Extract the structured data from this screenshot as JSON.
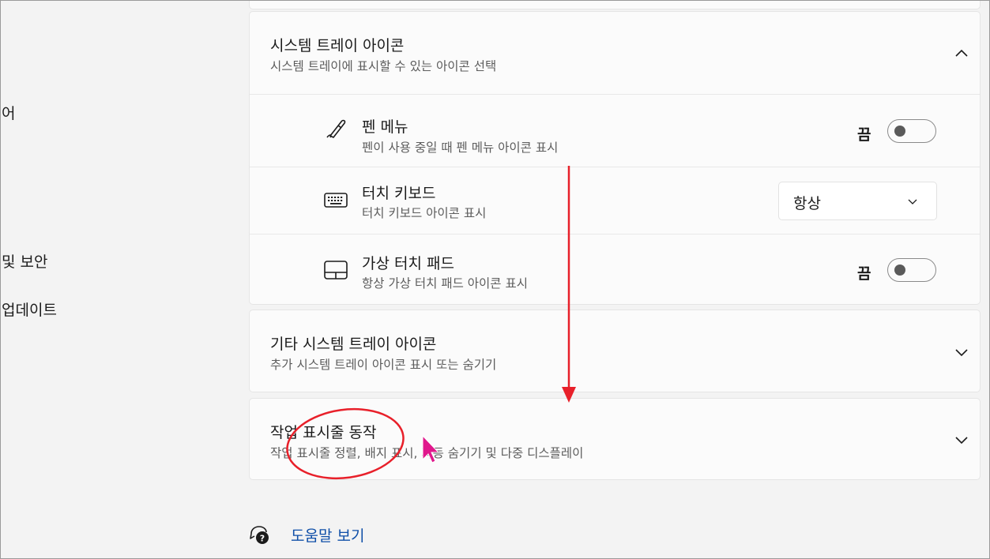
{
  "sidebar": {
    "items": [
      {
        "label": "어"
      },
      {
        "label": "및 보안"
      },
      {
        "label": "업데이트"
      }
    ]
  },
  "tray_icons_section": {
    "title": "시스템 트레이 아이콘",
    "subtitle": "시스템 트레이에 표시할 수 있는 아이콘 선택",
    "expanded": true,
    "rows": [
      {
        "icon": "pen-icon",
        "title": "펜 메뉴",
        "subtitle": "펜이 사용 중일 때 펜 메뉴 아이콘 표시",
        "control": "toggle",
        "state_label": "끔"
      },
      {
        "icon": "keyboard-icon",
        "title": "터치 키보드",
        "subtitle": "터치 키보드 아이콘 표시",
        "control": "dropdown",
        "value": "항상"
      },
      {
        "icon": "touchpad-icon",
        "title": "가상 터치 패드",
        "subtitle": "항상 가상 터치 패드 아이콘 표시",
        "control": "toggle",
        "state_label": "끔"
      }
    ]
  },
  "other_tray_section": {
    "title": "기타 시스템 트레이 아이콘",
    "subtitle": "추가 시스템 트레이 아이콘 표시 또는 숨기기"
  },
  "taskbar_behavior_section": {
    "title": "작업 표시줄 동작",
    "subtitle": "작업 표시줄 정렬, 배지 표시, 자동 숨기기 및 다중 디스플레이"
  },
  "help": {
    "label": "도움말 보기"
  },
  "colors": {
    "accent_link": "#0f4fa8",
    "annotation_red": "#e8202a",
    "cursor_magenta": "#e0188c"
  }
}
